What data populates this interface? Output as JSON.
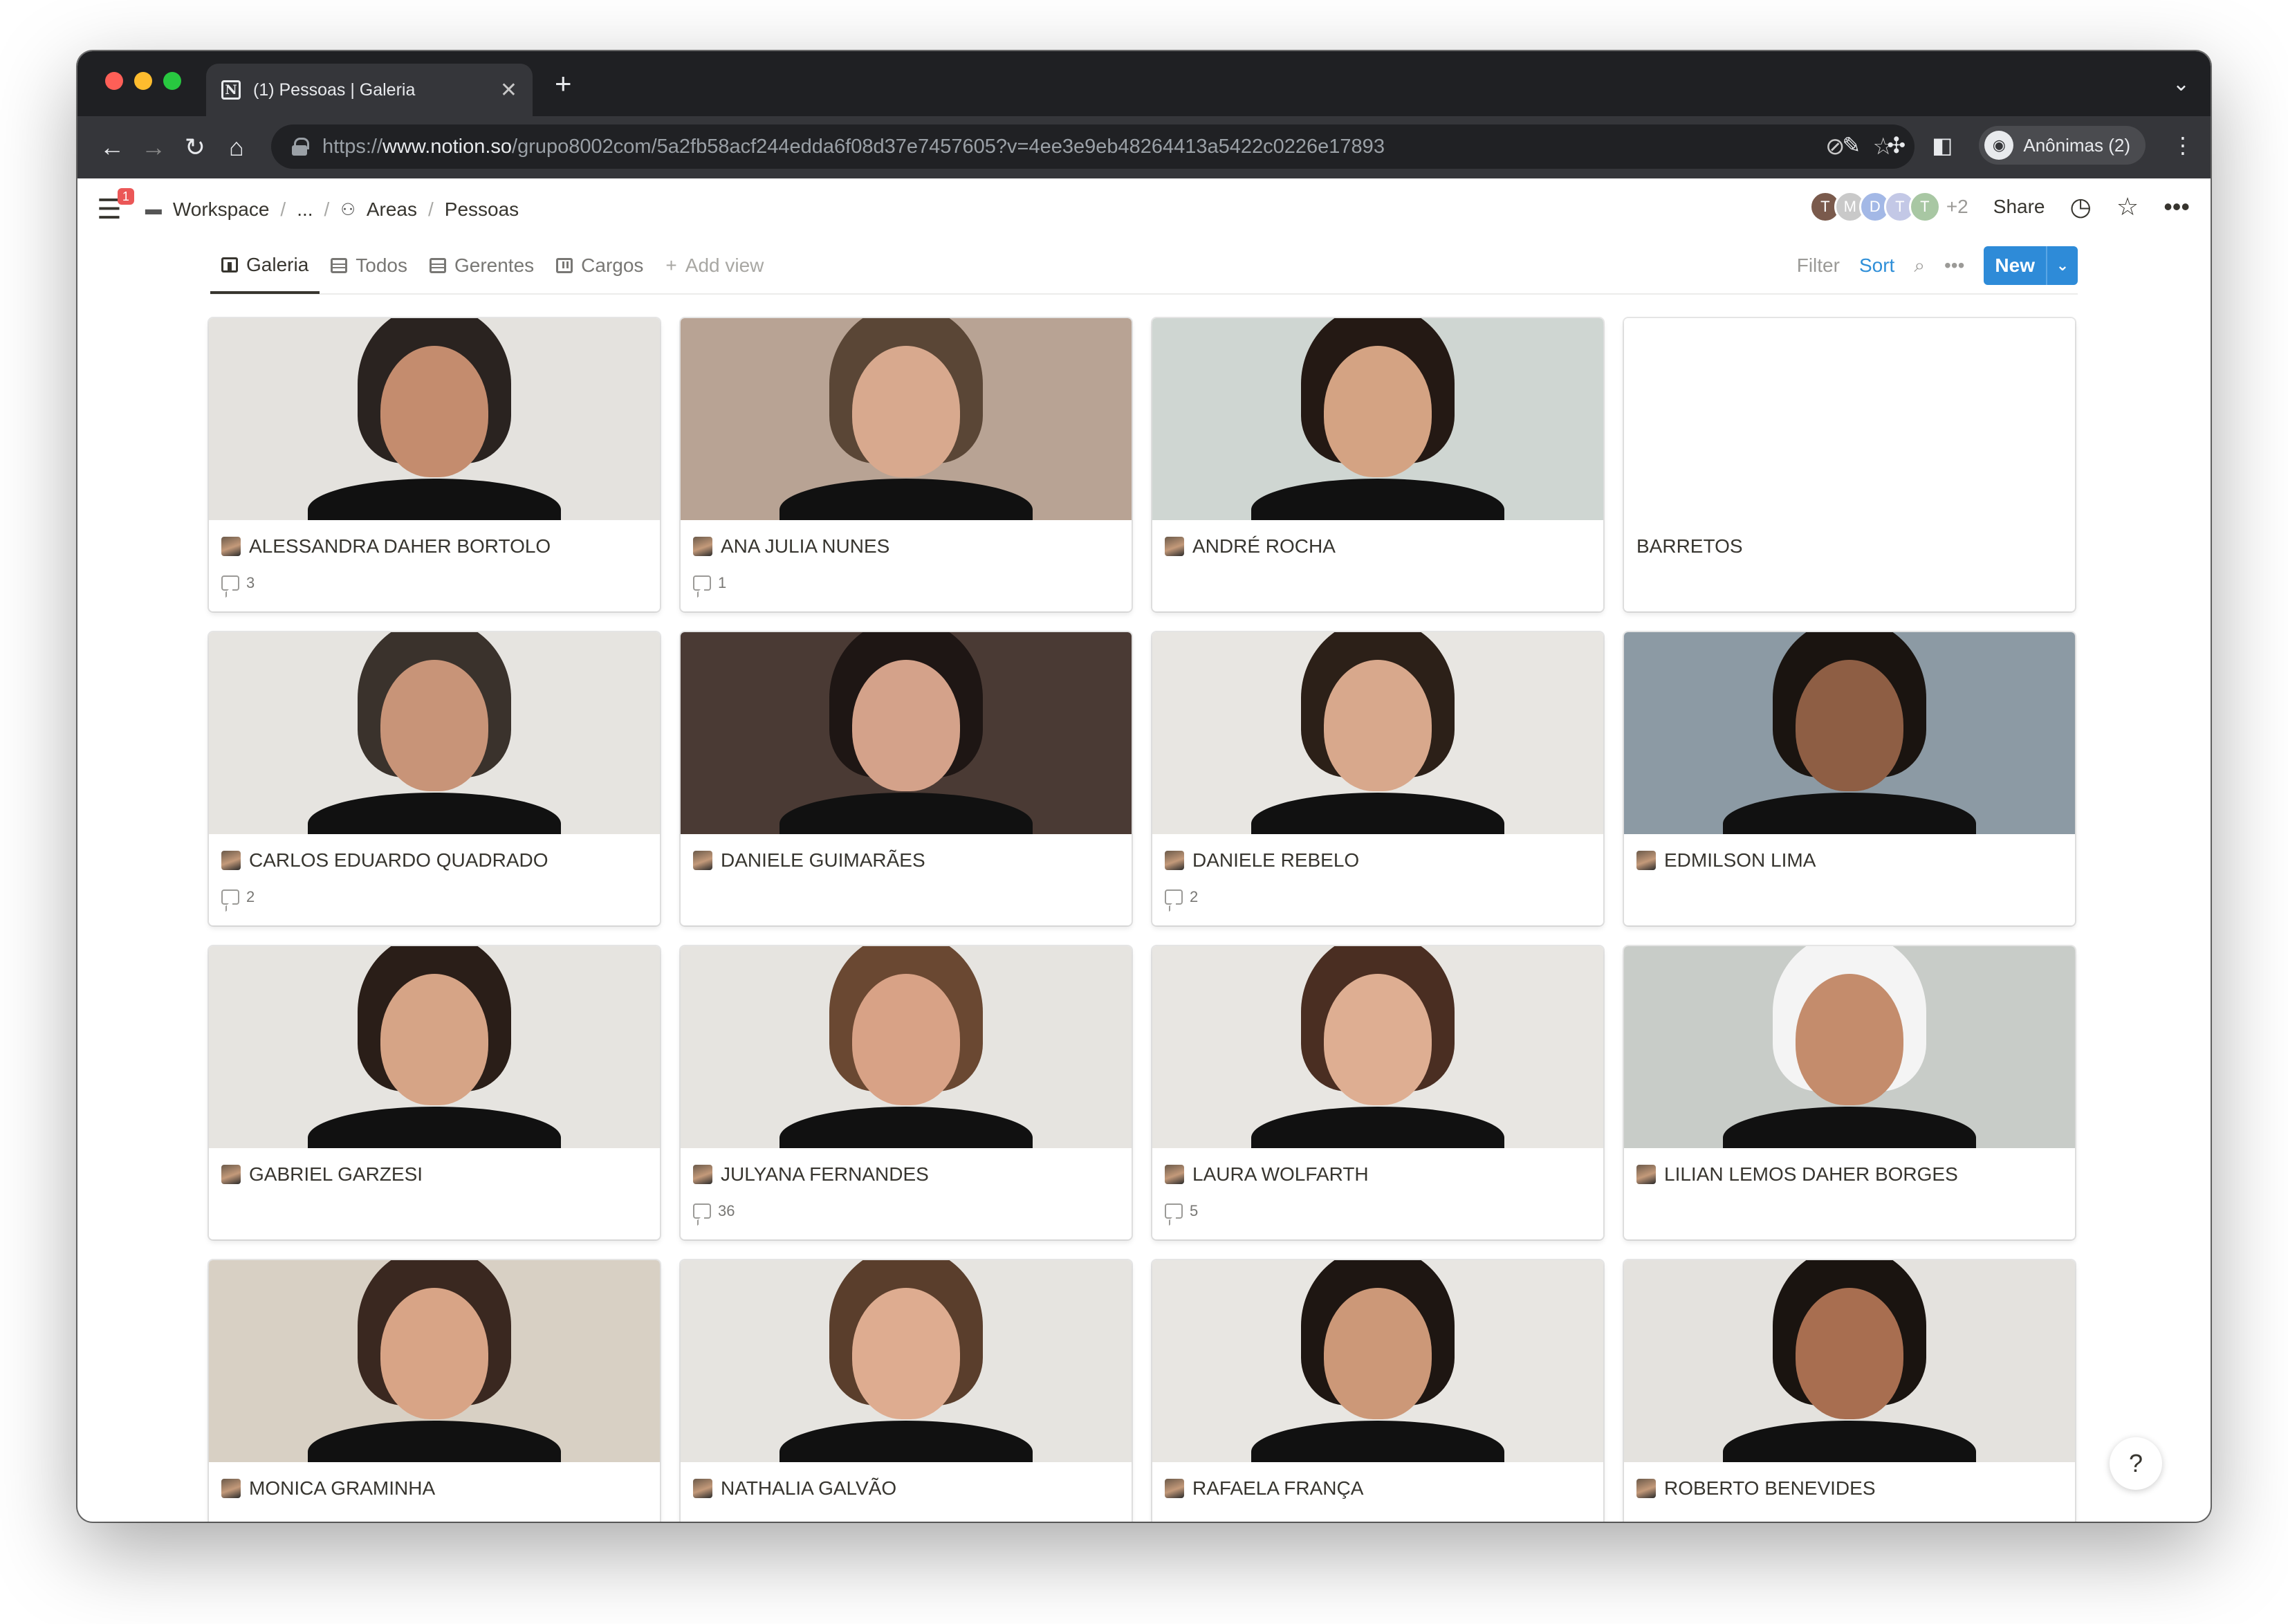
{
  "browser": {
    "tab_title": "(1) Pessoas | Galeria",
    "url_prefix": "https://",
    "url_host": "www.notion.so",
    "url_path": "/grupo8002com/5a2fb58acf244edda6f08d37e7457605?v=4ee3e9eb48264413a5422c0226e17893",
    "profile_label": "Anônimas (2)"
  },
  "notion": {
    "notification_count": "1",
    "breadcrumbs": [
      "Workspace",
      "...",
      "Areas",
      "Pessoas"
    ],
    "collaborators": [
      {
        "initial": "T",
        "color": "#7a5a4c"
      },
      {
        "initial": "M",
        "color": "#c9c9c9"
      },
      {
        "initial": "D",
        "color": "#a3b8e6"
      },
      {
        "initial": "T",
        "color": "#c3c8e6"
      },
      {
        "initial": "T",
        "color": "#a8c7a3"
      }
    ],
    "more_collaborators": "+2",
    "share_label": "Share"
  },
  "views": {
    "tabs": [
      "Galeria",
      "Todos",
      "Gerentes",
      "Cargos"
    ],
    "add_view": "Add view",
    "filter": "Filter",
    "sort": "Sort",
    "new_button": "New"
  },
  "gallery": [
    {
      "name": "ALESSANDRA DAHER BORTOLO",
      "comments": "3",
      "bg": "#e4e2de",
      "skin": "#c48c6e",
      "hair": "#2a2320"
    },
    {
      "name": "ANA JULIA NUNES",
      "comments": "1",
      "bg": "#b8a394",
      "skin": "#d8a98e",
      "hair": "#5a4636"
    },
    {
      "name": "ANDRÉ ROCHA",
      "comments": "",
      "bg": "#cfd6d2",
      "skin": "#d4a383",
      "hair": "#241914"
    },
    {
      "name": "BARRETOS",
      "comments": "",
      "bg": "",
      "skin": "",
      "hair": ""
    },
    {
      "name": "CARLOS EDUARDO QUADRADO",
      "comments": "2",
      "bg": "#e6e4e0",
      "skin": "#c89478",
      "hair": "#3a322c"
    },
    {
      "name": "DANIELE GUIMARÃES",
      "comments": "",
      "bg": "#4a3a34",
      "skin": "#d4a28a",
      "hair": "#1e1614"
    },
    {
      "name": "DANIELE REBELO",
      "comments": "2",
      "bg": "#e8e6e2",
      "skin": "#d8a88c",
      "hair": "#2c2018"
    },
    {
      "name": "EDMILSON LIMA",
      "comments": "",
      "bg": "#8c9aa4",
      "skin": "#8e5e44",
      "hair": "#1a1410"
    },
    {
      "name": "GABRIEL GARZESI",
      "comments": "",
      "bg": "#e6e4e0",
      "skin": "#d6a486",
      "hair": "#2a1e18"
    },
    {
      "name": "JULYANA FERNANDES",
      "comments": "36",
      "bg": "#e6e4e0",
      "skin": "#d8a286",
      "hair": "#6a4832"
    },
    {
      "name": "LAURA WOLFARTH",
      "comments": "5",
      "bg": "#e8e6e2",
      "skin": "#deae92",
      "hair": "#4a2e22"
    },
    {
      "name": "LILIAN LEMOS DAHER BORGES",
      "comments": "",
      "bg": "#c8ccc8",
      "skin": "#c48c6c",
      "hair": "#f4f4f4"
    },
    {
      "name": "MONICA GRAMINHA",
      "comments": "",
      "bg": "#d8d0c4",
      "skin": "#d8a486",
      "hair": "#3a2820"
    },
    {
      "name": "NATHALIA GALVÃO",
      "comments": "",
      "bg": "#e6e4e0",
      "skin": "#deac90",
      "hair": "#5a3e2c"
    },
    {
      "name": "RAFAELA FRANÇA",
      "comments": "",
      "bg": "#e8e6e2",
      "skin": "#cc9878",
      "hair": "#1e1612"
    },
    {
      "name": "ROBERTO BENEVIDES",
      "comments": "",
      "bg": "#e4e2de",
      "skin": "#a86e50",
      "hair": "#1a1410"
    }
  ]
}
